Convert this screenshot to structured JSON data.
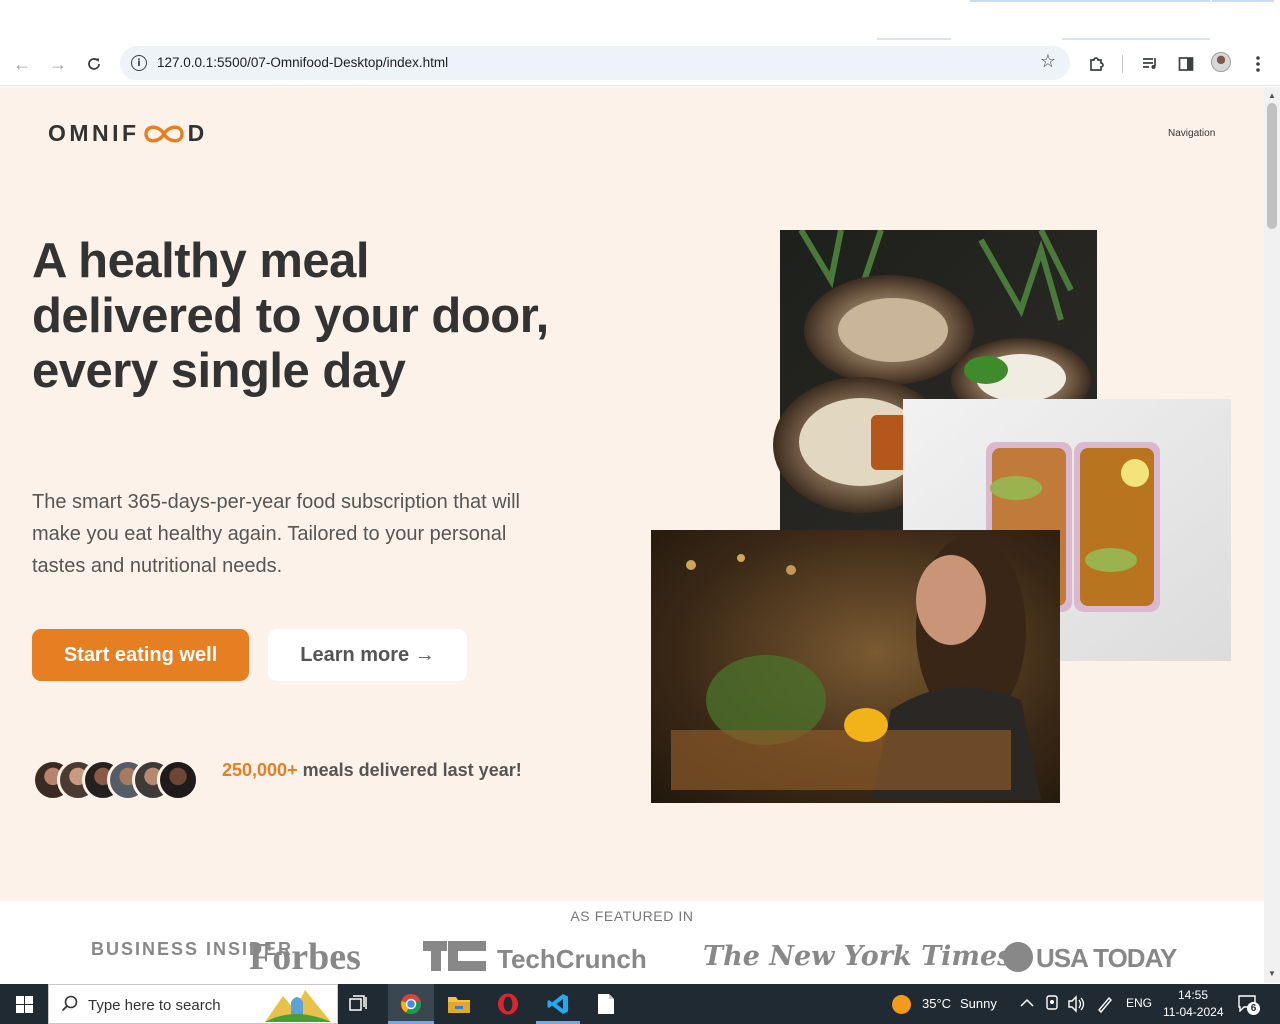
{
  "browser": {
    "url": "127.0.0.1:5500/07-Omnifood-Desktop/index.html",
    "back_glyph": "←",
    "forward_glyph": "→",
    "reload_glyph": "↻",
    "star_glyph": "☆"
  },
  "page": {
    "logo_pre": "OMNIF",
    "logo_post": "D",
    "nav_label": "Navigation",
    "hero": {
      "title": "A healthy meal delivered to your door, every single day",
      "description": "The smart 365-days-per-year food subscription that will make you eat healthy again. Tailored to your personal tastes and nutritional needs.",
      "primary_button": "Start eating well",
      "secondary_button": "Learn more →",
      "delivered_count": "250,000+",
      "delivered_text": " meals delivered last year!"
    },
    "featured": {
      "heading": "AS FEATURED IN",
      "logos": [
        "BUSINESS INSIDER",
        "Forbes",
        "TechCrunch",
        "The New York Times",
        "USA TODAY"
      ]
    },
    "colors": {
      "accent": "#e67e22",
      "background": "#fdf2e9",
      "text": "#333333"
    }
  },
  "taskbar": {
    "search_placeholder": "Type here to search",
    "weather_temp": "35°C",
    "weather_text": "Sunny",
    "language": "ENG",
    "time": "14:55",
    "date": "11-04-2024",
    "notifications": "6"
  }
}
